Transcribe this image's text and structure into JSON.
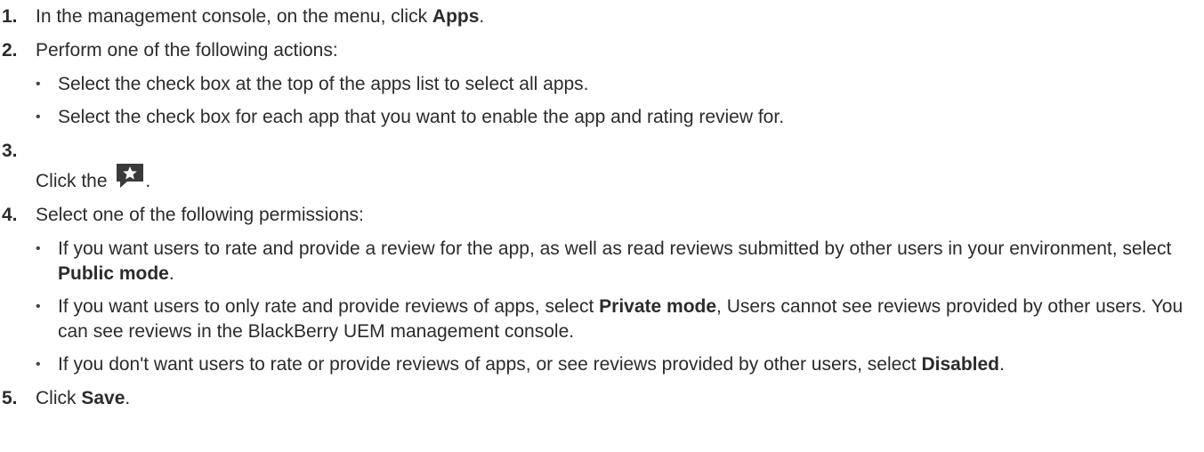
{
  "steps": [
    {
      "num": "1.",
      "parts": [
        "In the management console, on the menu, click ",
        "Apps",
        "."
      ]
    },
    {
      "num": "2.",
      "text": "Perform one of the following actions:",
      "substeps": [
        "Select the check box at the top of the apps list to select all apps.",
        "Select the check box for each app that you want to enable the app and rating review for."
      ]
    },
    {
      "num": "3.",
      "parts": [
        "Click the ",
        "."
      ],
      "icon": "rating-review-icon"
    },
    {
      "num": "4.",
      "text": "Select one of the following permissions:",
      "substeps": [
        {
          "a": "If you want users to rate and provide a review for the app, as well as read reviews submitted by other users in your environment, select ",
          "b": "Public mode",
          "c": "."
        },
        {
          "a": "If you want users to only rate and provide reviews of apps, select ",
          "b": "Private mode",
          "c": ", Users cannot see reviews provided by other users. You can see reviews in the BlackBerry UEM management console."
        },
        {
          "a": "If you don't want users to rate or provide reviews of apps, or see reviews provided by other users, select ",
          "b": "Disabled",
          "c": "."
        }
      ]
    },
    {
      "num": "5.",
      "parts": [
        "Click ",
        "Save",
        "."
      ]
    }
  ],
  "bullet_char": "•",
  "colors": {
    "text": "#2b2b2b",
    "icon_bg": "#3a3a3a",
    "icon_star": "#ffffff"
  }
}
